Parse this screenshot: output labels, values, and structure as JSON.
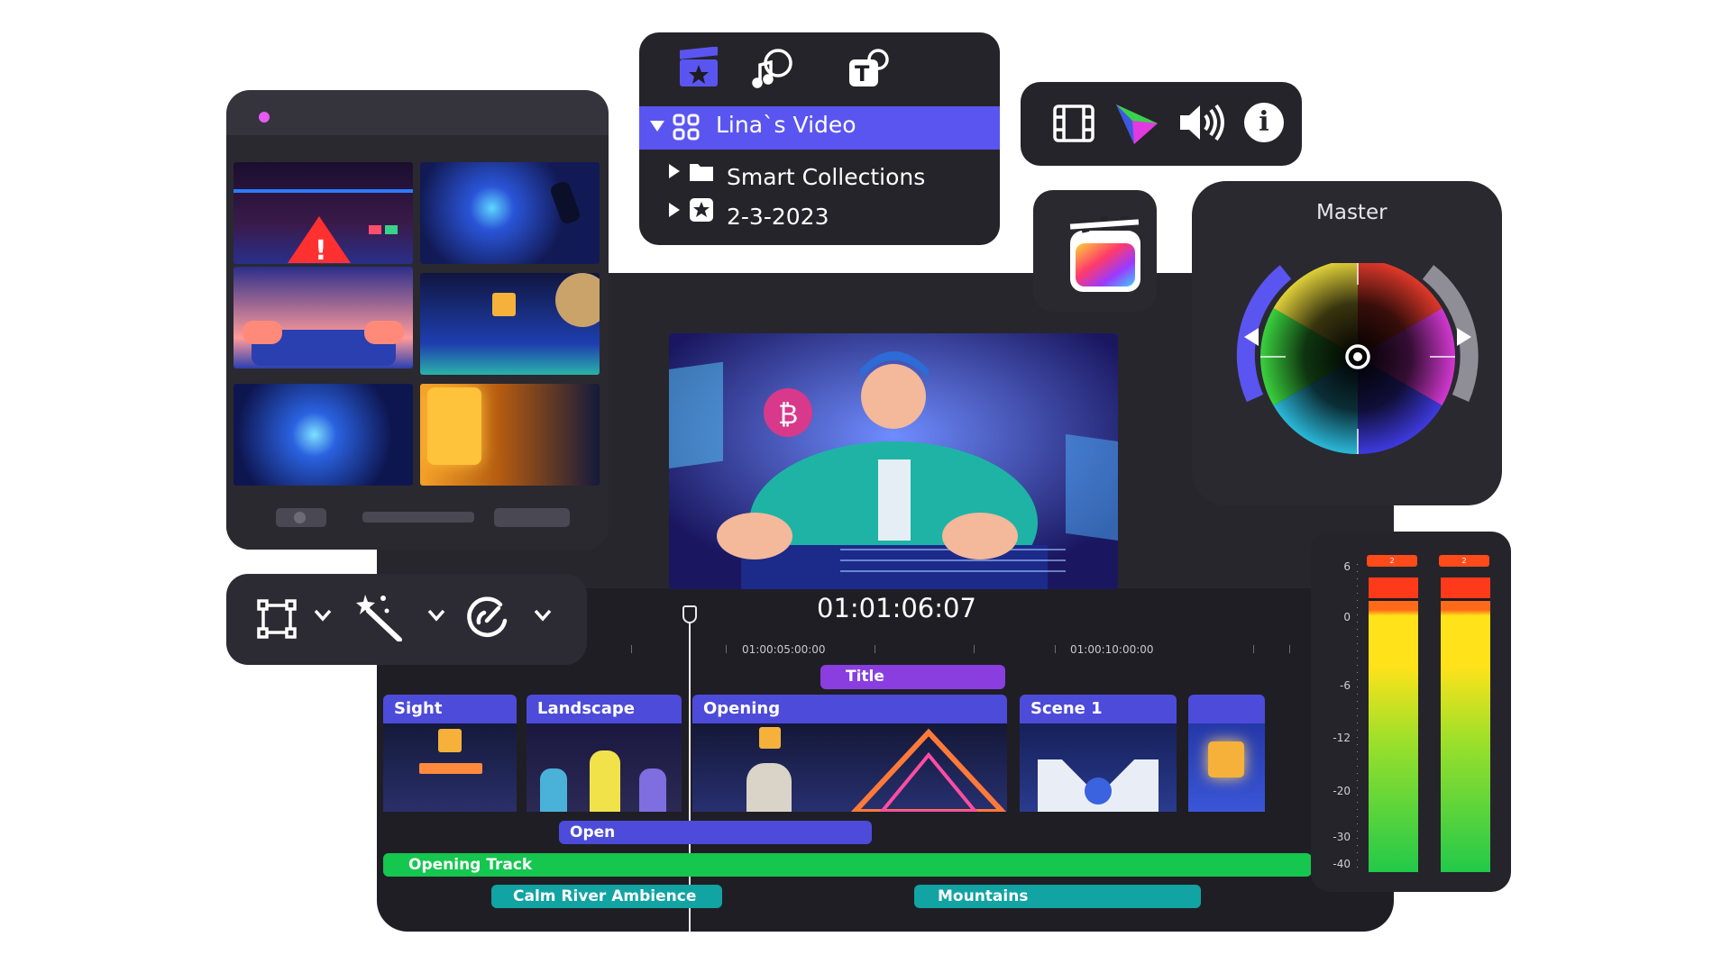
{
  "browser": {
    "project": "Lina`s Video",
    "items": [
      {
        "label": "Smart Collections"
      },
      {
        "label": "2-3-2023"
      }
    ]
  },
  "color": {
    "title": "Master"
  },
  "timeline": {
    "timecode": "01:01:06:07",
    "ruler_marks": [
      "01:00:05:00:00",
      "01:00:10:00:00"
    ],
    "title_clip": "Title",
    "video_clips": [
      "Sight",
      "Landscape",
      "Opening",
      "Scene 1"
    ],
    "connected_clip": "Open",
    "audio": [
      "Opening Track",
      "Calm River Ambience",
      "Mountains"
    ]
  },
  "meters": {
    "scale": [
      "6",
      "0",
      "-6",
      "-12",
      "-20",
      "-30",
      "-40"
    ],
    "peak_labels": [
      "2",
      "2"
    ]
  },
  "colors": {
    "accent": "#5a55f0",
    "clip": "#4d4bd9",
    "title_clip": "#8a3ee0",
    "audio_green": "#15c64f",
    "audio_teal": "#12a3a3"
  }
}
